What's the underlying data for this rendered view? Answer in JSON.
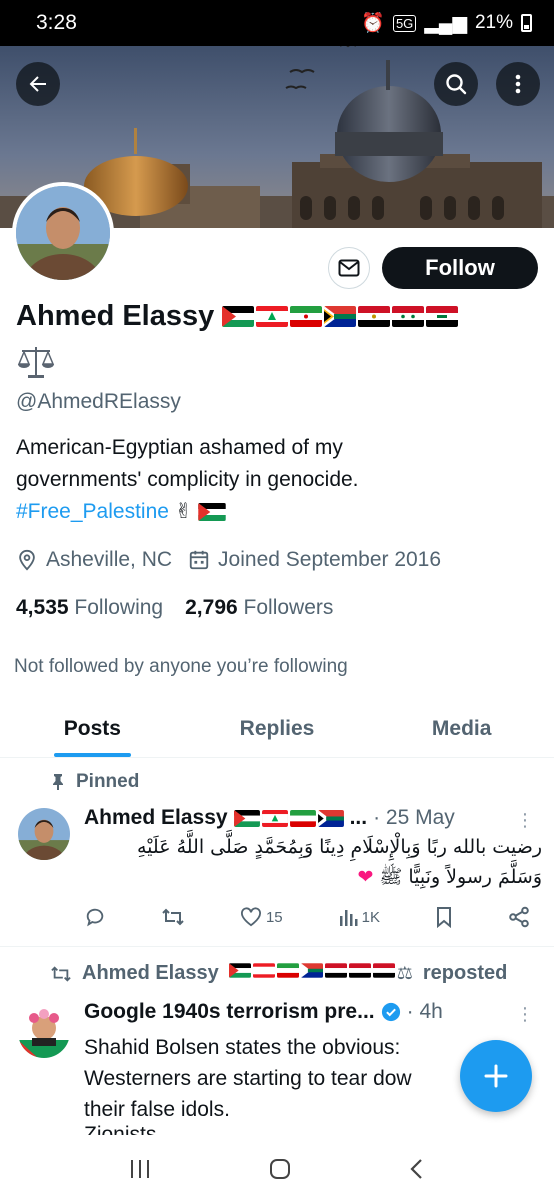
{
  "status_bar": {
    "time": "3:28",
    "network": "5G",
    "battery": "21%"
  },
  "header": {
    "back_icon": "arrow-left-icon",
    "search_icon": "search-icon",
    "more_icon": "more-vertical-icon"
  },
  "profile": {
    "name": "Ahmed Elassy",
    "name_flags": [
      "palestine",
      "lebanon",
      "iran",
      "south-africa",
      "egypt",
      "syria",
      "iraq"
    ],
    "name_extra_icon": "balance-scale-icon",
    "handle": "@AhmedRElassy",
    "bio_line1": "American-Egyptian ashamed of my",
    "bio_line2": "governments' complicity in genocide.",
    "bio_hashtag": "#Free_Palestine",
    "location": "Asheville, NC",
    "joined": "Joined September 2016",
    "following_count": "4,535",
    "following_label": "Following",
    "followers_count": "2,796",
    "followers_label": "Followers",
    "not_followed_note": "Not followed by anyone you’re following",
    "follow_label": "Follow",
    "message_icon": "envelope-icon"
  },
  "tabs": [
    {
      "label": "Posts",
      "active": true
    },
    {
      "label": "Replies",
      "active": false
    },
    {
      "label": "Media",
      "active": false
    }
  ],
  "pinned_post": {
    "pinned_label": "Pinned",
    "author": "Ahmed Elassy",
    "author_flags_truncated": "...",
    "date": "· 25 May",
    "text_line1": "رضيت بالله ربًا وَبِالْإِسْلَامِ دِينًا وَبِمُحَمَّدٍ صَلَّى اللَّهُ عَلَيْهِ",
    "text_line2": "وَسَلَّمَ رسولاً ونَبِيًّا ﷺ",
    "likes": "15",
    "views": "1K"
  },
  "repost": {
    "reposter": "Ahmed Elassy",
    "reposted_label": "reposted",
    "author": "Google 1940s terrorism pre...",
    "time": "· 4h",
    "text_line1": "Shahid Bolsen states the obvious:",
    "text_line2": "Westerners are starting to tear dow",
    "text_line3": "their false idols.",
    "text_line4": "Zionists"
  },
  "colors": {
    "accent": "#1d9bf0",
    "text_primary": "#0f1419",
    "text_secondary": "#536471",
    "like_heart": "#f91880"
  }
}
